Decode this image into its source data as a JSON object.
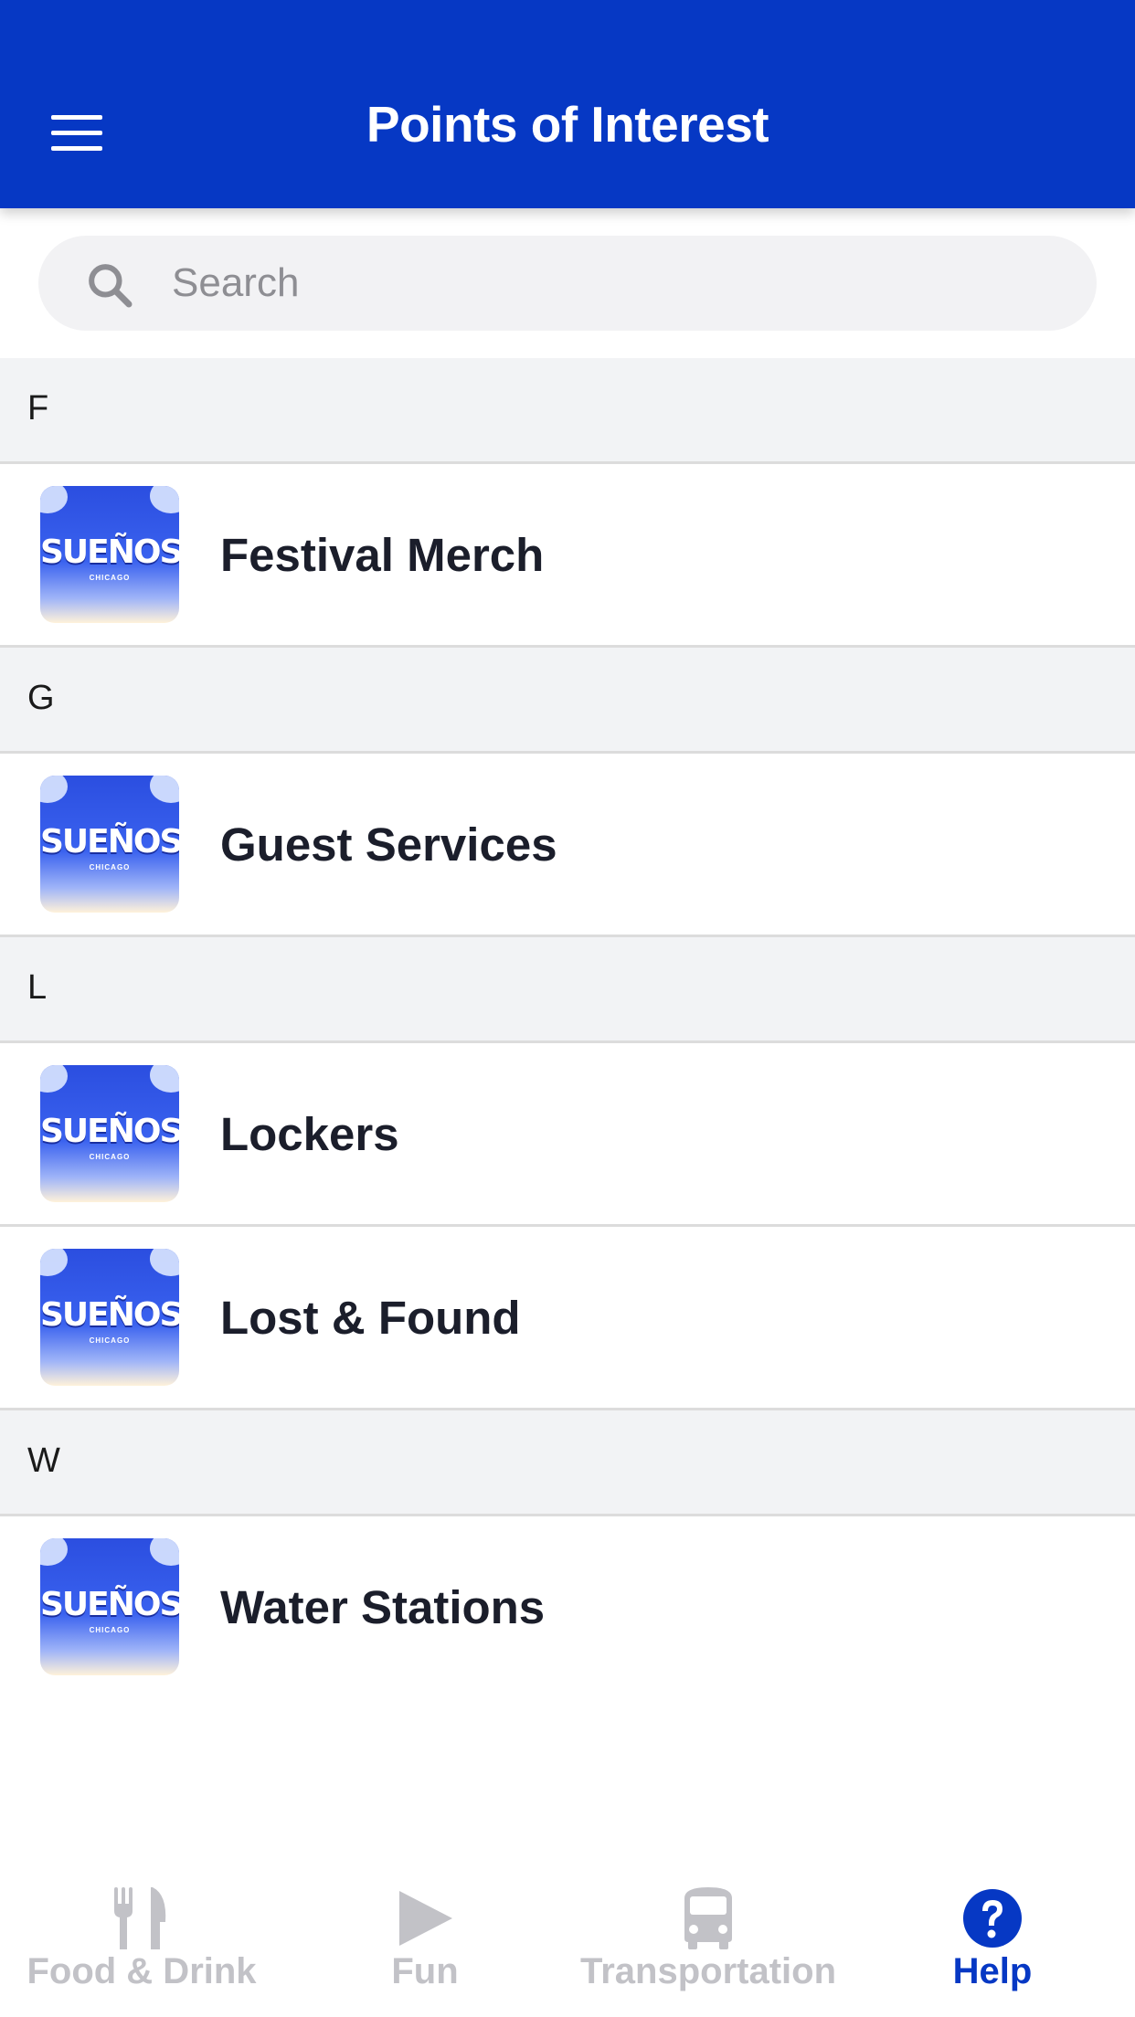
{
  "header": {
    "title": "Points of Interest"
  },
  "search": {
    "placeholder": "Search",
    "value": ""
  },
  "sections": [
    {
      "letter": "F",
      "items": [
        {
          "label": "Festival Merch",
          "thumb_text": "SUEÑOS",
          "thumb_sub": "CHICAGO"
        }
      ]
    },
    {
      "letter": "G",
      "items": [
        {
          "label": "Guest Services",
          "thumb_text": "SUEÑOS",
          "thumb_sub": "CHICAGO"
        }
      ]
    },
    {
      "letter": "L",
      "items": [
        {
          "label": "Lockers",
          "thumb_text": "SUEÑOS",
          "thumb_sub": "CHICAGO"
        },
        {
          "label": "Lost & Found",
          "thumb_text": "SUEÑOS",
          "thumb_sub": "CHICAGO"
        }
      ]
    },
    {
      "letter": "W",
      "items": [
        {
          "label": "Water Stations",
          "thumb_text": "SUEÑOS",
          "thumb_sub": "CHICAGO"
        }
      ]
    }
  ],
  "tabs": [
    {
      "label": "Food & Drink",
      "icon": "utensils-icon",
      "active": false
    },
    {
      "label": "Fun",
      "icon": "play-icon",
      "active": false
    },
    {
      "label": "Transportation",
      "icon": "bus-icon",
      "active": false
    },
    {
      "label": "Help",
      "icon": "question-circle-icon",
      "active": true
    }
  ],
  "colors": {
    "brand": "#0638c4",
    "section_bg": "#f2f3f5",
    "inactive_tab": "#c2c2c7",
    "text": "#1b1e2b"
  }
}
